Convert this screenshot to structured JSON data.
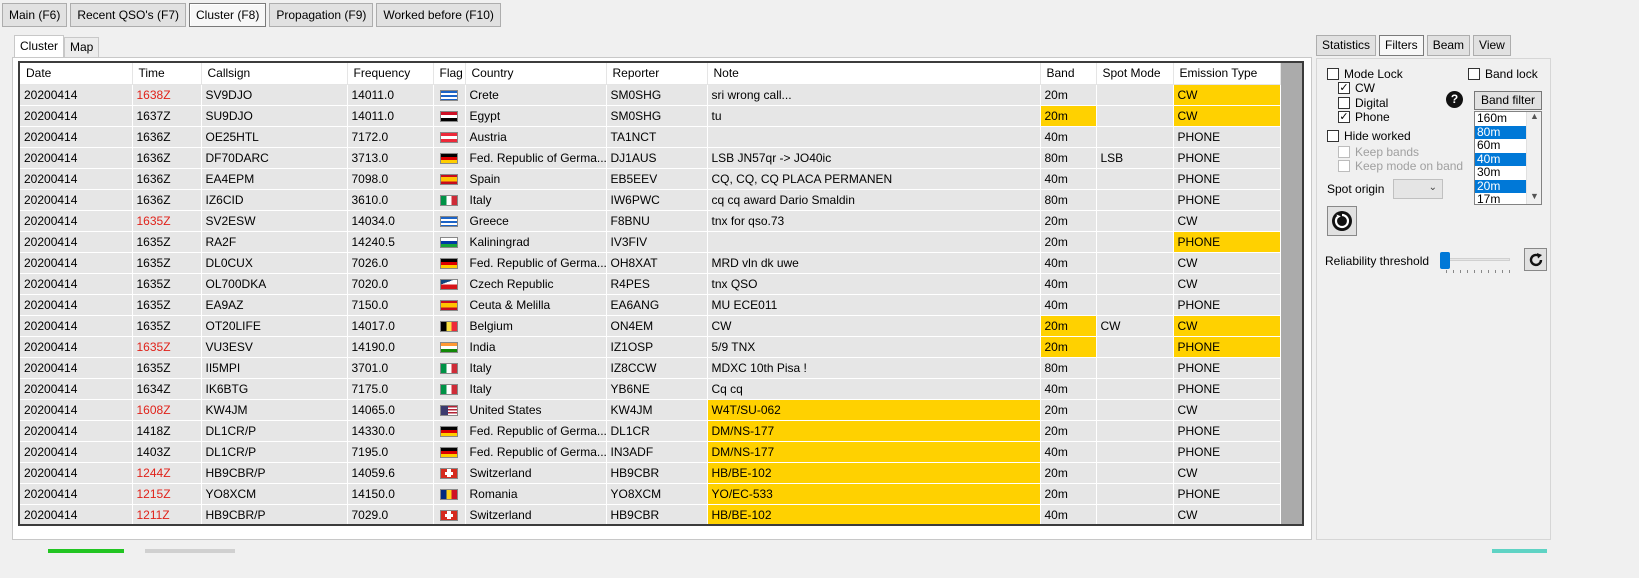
{
  "top_tabs": [
    "Main (F6)",
    "Recent QSO's (F7)",
    "Cluster (F8)",
    "Propagation (F9)",
    "Worked before (F10)"
  ],
  "left_tabs": [
    "Cluster",
    "Map"
  ],
  "columns": [
    "Date",
    "Time",
    "Callsign",
    "Frequency",
    "Flag",
    "Country",
    "Reporter",
    "Note",
    "Band",
    "Spot Mode",
    "Emission Type"
  ],
  "rows": [
    {
      "date": "20200414",
      "time": "1638Z",
      "time_red": true,
      "call": "SV9DJO",
      "freq": "14011.0",
      "flag": "gr",
      "country": "Crete",
      "reporter": "SM0SHG",
      "note": "sri wrong call...",
      "note_hl": false,
      "band": "20m",
      "band_hl": false,
      "mode": "",
      "emission": "CW",
      "em_hl": true
    },
    {
      "date": "20200414",
      "time": "1637Z",
      "time_red": false,
      "call": "SU9DJO",
      "freq": "14011.0",
      "flag": "eg",
      "country": "Egypt",
      "reporter": "SM0SHG",
      "note": "tu",
      "note_hl": false,
      "band": "20m",
      "band_hl": true,
      "mode": "",
      "emission": "CW",
      "em_hl": true
    },
    {
      "date": "20200414",
      "time": "1636Z",
      "time_red": false,
      "call": "OE25HTL",
      "freq": "7172.0",
      "flag": "at",
      "country": "Austria",
      "reporter": "TA1NCT",
      "note": "",
      "note_hl": false,
      "band": "40m",
      "band_hl": false,
      "mode": "",
      "emission": "PHONE",
      "em_hl": false
    },
    {
      "date": "20200414",
      "time": "1636Z",
      "time_red": false,
      "call": "DF70DARC",
      "freq": "3713.0",
      "flag": "de",
      "country": "Fed. Republic of Germa...",
      "reporter": "DJ1AUS",
      "note": "LSB JN57qr -> JO40ic",
      "note_hl": false,
      "band": "80m",
      "band_hl": false,
      "mode": "LSB",
      "emission": "PHONE",
      "em_hl": false
    },
    {
      "date": "20200414",
      "time": "1636Z",
      "time_red": false,
      "call": "EA4EPM",
      "freq": "7098.0",
      "flag": "es",
      "country": "Spain",
      "reporter": "EB5EEV",
      "note": "CQ, CQ, CQ PLACA PERMANEN",
      "note_hl": false,
      "band": "40m",
      "band_hl": false,
      "mode": "",
      "emission": "PHONE",
      "em_hl": false
    },
    {
      "date": "20200414",
      "time": "1636Z",
      "time_red": false,
      "call": "IZ6CID",
      "freq": "3610.0",
      "flag": "it",
      "country": "Italy",
      "reporter": "IW6PWC",
      "note": "cq cq award Dario Smaldin",
      "note_hl": false,
      "band": "80m",
      "band_hl": false,
      "mode": "",
      "emission": "PHONE",
      "em_hl": false
    },
    {
      "date": "20200414",
      "time": "1635Z",
      "time_red": true,
      "call": "SV2ESW",
      "freq": "14034.0",
      "flag": "gr",
      "country": "Greece",
      "reporter": "F8BNU",
      "note": "tnx for qso.73",
      "note_hl": false,
      "band": "20m",
      "band_hl": false,
      "mode": "",
      "emission": "CW",
      "em_hl": false
    },
    {
      "date": "20200414",
      "time": "1635Z",
      "time_red": false,
      "call": "RA2F",
      "freq": "14240.5",
      "flag": "kal",
      "country": "Kaliningrad",
      "reporter": "IV3FIV",
      "note": "",
      "note_hl": false,
      "band": "20m",
      "band_hl": false,
      "mode": "",
      "emission": "PHONE",
      "em_hl": true
    },
    {
      "date": "20200414",
      "time": "1635Z",
      "time_red": false,
      "call": "DL0CUX",
      "freq": "7026.0",
      "flag": "de",
      "country": "Fed. Republic of Germa...",
      "reporter": "OH8XAT",
      "note": "MRD   vln dk uwe",
      "note_hl": false,
      "band": "40m",
      "band_hl": false,
      "mode": "",
      "emission": "CW",
      "em_hl": false
    },
    {
      "date": "20200414",
      "time": "1635Z",
      "time_red": false,
      "call": "OL700DKA",
      "freq": "7020.0",
      "flag": "cz",
      "country": "Czech Republic",
      "reporter": "R4PES",
      "note": "tnx QSO",
      "note_hl": false,
      "band": "40m",
      "band_hl": false,
      "mode": "",
      "emission": "CW",
      "em_hl": false
    },
    {
      "date": "20200414",
      "time": "1635Z",
      "time_red": false,
      "call": "EA9AZ",
      "freq": "7150.0",
      "flag": "es",
      "country": "Ceuta & Melilla",
      "reporter": "EA6ANG",
      "note": "MU ECE011",
      "note_hl": false,
      "band": "40m",
      "band_hl": false,
      "mode": "",
      "emission": "PHONE",
      "em_hl": false
    },
    {
      "date": "20200414",
      "time": "1635Z",
      "time_red": false,
      "call": "OT20LIFE",
      "freq": "14017.0",
      "flag": "be",
      "country": "Belgium",
      "reporter": "ON4EM",
      "note": "CW",
      "note_hl": false,
      "band": "20m",
      "band_hl": true,
      "mode": "CW",
      "emission": "CW",
      "em_hl": true
    },
    {
      "date": "20200414",
      "time": "1635Z",
      "time_red": true,
      "call": "VU3ESV",
      "freq": "14190.0",
      "flag": "in",
      "country": "India",
      "reporter": "IZ1OSP",
      "note": "5/9 TNX",
      "note_hl": false,
      "band": "20m",
      "band_hl": true,
      "mode": "",
      "emission": "PHONE",
      "em_hl": true
    },
    {
      "date": "20200414",
      "time": "1635Z",
      "time_red": false,
      "call": "II5MPI",
      "freq": "3701.0",
      "flag": "it",
      "country": "Italy",
      "reporter": "IZ8CCW",
      "note": "MDXC 10th Pisa !",
      "note_hl": false,
      "band": "80m",
      "band_hl": false,
      "mode": "",
      "emission": "PHONE",
      "em_hl": false
    },
    {
      "date": "20200414",
      "time": "1634Z",
      "time_red": false,
      "call": "IK6BTG",
      "freq": "7175.0",
      "flag": "it",
      "country": "Italy",
      "reporter": "YB6NE",
      "note": "Cq cq",
      "note_hl": false,
      "band": "40m",
      "band_hl": false,
      "mode": "",
      "emission": "PHONE",
      "em_hl": false
    },
    {
      "date": "20200414",
      "time": "1608Z",
      "time_red": true,
      "call": "KW4JM",
      "freq": "14065.0",
      "flag": "us",
      "country": "United States",
      "reporter": "KW4JM",
      "note": "W4T/SU-062",
      "note_hl": true,
      "band": "20m",
      "band_hl": false,
      "mode": "",
      "emission": "CW",
      "em_hl": false
    },
    {
      "date": "20200414",
      "time": "1418Z",
      "time_red": false,
      "call": "DL1CR/P",
      "freq": "14330.0",
      "flag": "de",
      "country": "Fed. Republic of Germa...",
      "reporter": "DL1CR",
      "note": "DM/NS-177",
      "note_hl": true,
      "band": "20m",
      "band_hl": false,
      "mode": "",
      "emission": "PHONE",
      "em_hl": false
    },
    {
      "date": "20200414",
      "time": "1403Z",
      "time_red": false,
      "call": "DL1CR/P",
      "freq": "7195.0",
      "flag": "de",
      "country": "Fed. Republic of Germa...",
      "reporter": "IN3ADF",
      "note": "DM/NS-177",
      "note_hl": true,
      "band": "40m",
      "band_hl": false,
      "mode": "",
      "emission": "PHONE",
      "em_hl": false
    },
    {
      "date": "20200414",
      "time": "1244Z",
      "time_red": true,
      "call": "HB9CBR/P",
      "freq": "14059.6",
      "flag": "ch",
      "country": "Switzerland",
      "reporter": "HB9CBR",
      "note": "HB/BE-102",
      "note_hl": true,
      "band": "20m",
      "band_hl": false,
      "mode": "",
      "emission": "CW",
      "em_hl": false
    },
    {
      "date": "20200414",
      "time": "1215Z",
      "time_red": true,
      "call": "YO8XCM",
      "freq": "14150.0",
      "flag": "ro",
      "country": "Romania",
      "reporter": "YO8XCM",
      "note": "YO/EC-533",
      "note_hl": true,
      "band": "20m",
      "band_hl": false,
      "mode": "",
      "emission": "PHONE",
      "em_hl": false
    },
    {
      "date": "20200414",
      "time": "1211Z",
      "time_red": true,
      "call": "HB9CBR/P",
      "freq": "7029.0",
      "flag": "ch",
      "country": "Switzerland",
      "reporter": "HB9CBR",
      "note": "HB/BE-102",
      "note_hl": true,
      "band": "40m",
      "band_hl": false,
      "mode": "",
      "emission": "CW",
      "em_hl": false
    }
  ],
  "right_tabs": [
    "Statistics",
    "Filters",
    "Beam",
    "View"
  ],
  "filters": {
    "mode_lock": "Mode Lock",
    "cw": "CW",
    "digital": "Digital",
    "phone": "Phone",
    "hide_worked": "Hide worked",
    "keep_bands": "Keep bands",
    "keep_mode": "Keep mode on band",
    "band_lock": "Band lock",
    "band_filter": "Band filter",
    "help": "?",
    "spot_origin": "Spot origin",
    "reliability": "Reliability threshold",
    "checked": {
      "mode_lock": false,
      "cw": true,
      "digital": false,
      "phone": true,
      "hide_worked": false,
      "keep_bands": false,
      "keep_mode": false,
      "band_lock": false
    },
    "reliability_level": 0
  },
  "band_list": [
    {
      "label": "160m",
      "sel": false
    },
    {
      "label": "80m",
      "sel": true
    },
    {
      "label": "60m",
      "sel": false
    },
    {
      "label": "40m",
      "sel": true
    },
    {
      "label": "30m",
      "sel": false
    },
    {
      "label": "20m",
      "sel": true
    },
    {
      "label": "17m",
      "sel": false
    }
  ],
  "colors": {
    "highlight": "#ffd100",
    "red_time": "#e0221a",
    "selection": "#0078d7"
  }
}
